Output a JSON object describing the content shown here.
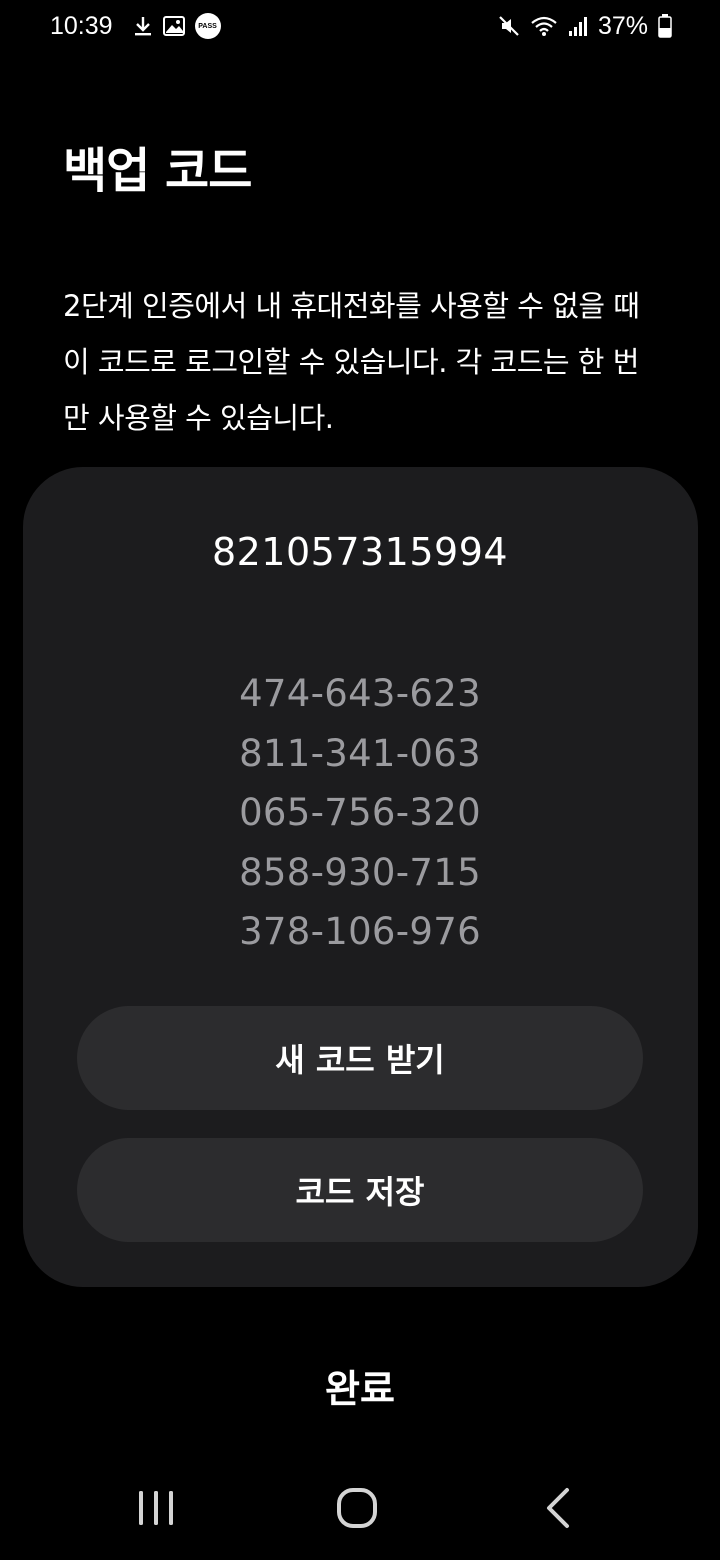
{
  "status_bar": {
    "time": "10:39",
    "pass_badge": "PASS",
    "battery": "37%",
    "icons_left": [
      "download-icon",
      "image-icon",
      "pass-icon"
    ],
    "icons_right": [
      "mute-icon",
      "wifi-icon",
      "signal-icon",
      "battery-icon"
    ]
  },
  "page": {
    "title": "백업 코드",
    "description": "2단계 인증에서 내 휴대전화를 사용할 수 없을 때 이 코드로 로그인할 수 있습니다. 각 코드는 한 번만 사용할 수 있습니다."
  },
  "codes": {
    "primary": "821057315994",
    "list": [
      "474-643-623",
      "811-341-063",
      "065-756-320",
      "858-930-715",
      "378-106-976"
    ]
  },
  "buttons": {
    "new_codes": "새 코드 받기",
    "save_codes": "코드 저장",
    "done": "완료"
  },
  "colors": {
    "background": "#000000",
    "card": "#1c1c1e",
    "button": "#2c2c2e",
    "secondary_text": "#9b9b9f"
  },
  "nav_bar": {
    "icons": [
      "recents-icon",
      "home-icon",
      "back-icon"
    ]
  }
}
